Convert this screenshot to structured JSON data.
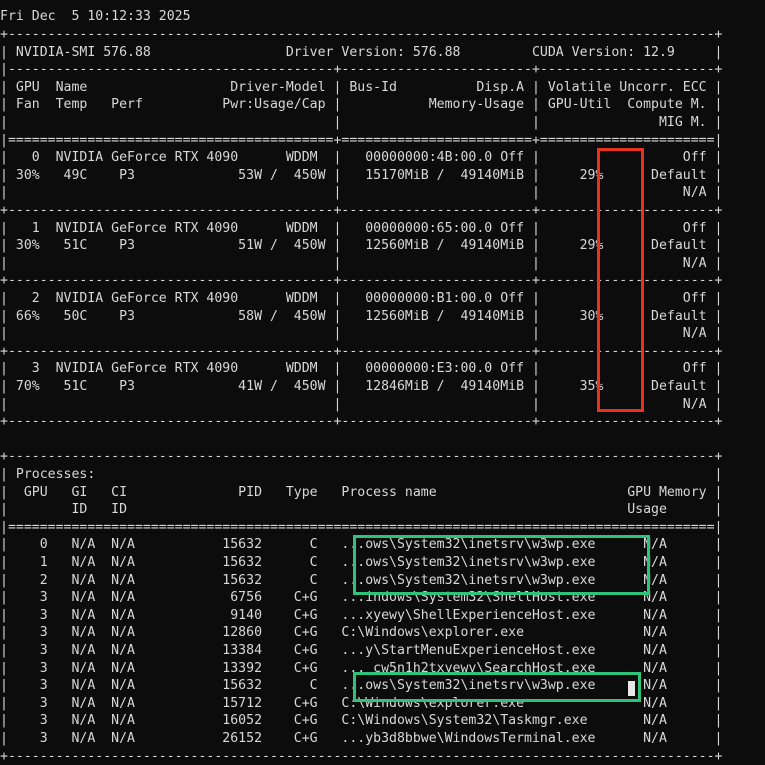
{
  "timestamp": "Fri Dec  5 10:12:33 2025",
  "terminal_lines": [
    "+-----------------------------------------------------------------------------------------+",
    "| NVIDIA-SMI 576.88                 Driver Version: 576.88         CUDA Version: 12.9     |",
    "|-----------------------------------------+------------------------+----------------------+",
    "| GPU  Name                  Driver-Model | Bus-Id          Disp.A | Volatile Uncorr. ECC |",
    "| Fan  Temp   Perf          Pwr:Usage/Cap |           Memory-Usage | GPU-Util  Compute M. |",
    "|                                         |                        |               MIG M. |",
    "|=========================================+========================+======================|",
    "|   0  NVIDIA GeForce RTX 4090      WDDM  |   00000000:4B:00.0 Off |                  Off |",
    "| 30%   49C    P3             53W /  450W |   15170MiB /  49140MiB |     29%      Default |",
    "|                                         |                        |                  N/A |",
    "+-----------------------------------------+------------------------+----------------------+",
    "|   1  NVIDIA GeForce RTX 4090      WDDM  |   00000000:65:00.0 Off |                  Off |",
    "| 30%   51C    P3             51W /  450W |   12560MiB /  49140MiB |     29%      Default |",
    "|                                         |                        |                  N/A |",
    "+-----------------------------------------+------------------------+----------------------+",
    "|   2  NVIDIA GeForce RTX 4090      WDDM  |   00000000:B1:00.0 Off |                  Off |",
    "| 66%   50C    P3             58W /  450W |   12560MiB /  49140MiB |     30%      Default |",
    "|                                         |                        |                  N/A |",
    "+-----------------------------------------+------------------------+----------------------+",
    "|   3  NVIDIA GeForce RTX 4090      WDDM  |   00000000:E3:00.0 Off |                  Off |",
    "| 70%   51C    P3             41W /  450W |   12846MiB /  49140MiB |     35%      Default |",
    "|                                         |                        |                  N/A |",
    "+-----------------------------------------+------------------------+----------------------+",
    "",
    "+-----------------------------------------------------------------------------------------+",
    "| Processes:                                                                              |",
    "|  GPU   GI   CI              PID   Type   Process name                        GPU Memory |",
    "|        ID   ID                                                               Usage      |",
    "|=========================================================================================|",
    "|    0   N/A  N/A           15632      C   ...ows\\System32\\inetsrv\\w3wp.exe      N/A      |",
    "|    1   N/A  N/A           15632      C   ...ows\\System32\\inetsrv\\w3wp.exe      N/A      |",
    "|    2   N/A  N/A           15632      C   ...ows\\System32\\inetsrv\\w3wp.exe      N/A      |",
    "|    3   N/A  N/A            6756    C+G   ...indows\\System32\\ShellHost.exe      N/A      |",
    "|    3   N/A  N/A            9140    C+G   ...xyewy\\ShellExperienceHost.exe      N/A      |",
    "|    3   N/A  N/A           12860    C+G   C:\\Windows\\explorer.exe               N/A      |",
    "|    3   N/A  N/A           13384    C+G   ...y\\StartMenuExperienceHost.exe      N/A      |",
    "|    3   N/A  N/A           13392    C+G   ..._cw5n1h2txyewy\\SearchHost.exe      N/A      |",
    "|    3   N/A  N/A           15632      C   ...ows\\System32\\inetsrv\\w3wp.exe      N/A      |",
    "|    3   N/A  N/A           15712    C+G   C:\\Windows\\explorer.exe               N/A      |",
    "|    3   N/A  N/A           16052    C+G   C:\\Windows\\System32\\Taskmgr.exe       N/A      |",
    "|    3   N/A  N/A           26152    C+G   ...yb3d8bbwe\\WindowsTerminal.exe      N/A      |",
    "+-----------------------------------------------------------------------------------------+"
  ],
  "colors": {
    "background": "#0c0c0c",
    "text": "#d8d8d8",
    "highlight_red": "#e8321e",
    "highlight_green": "#2fc27a"
  }
}
